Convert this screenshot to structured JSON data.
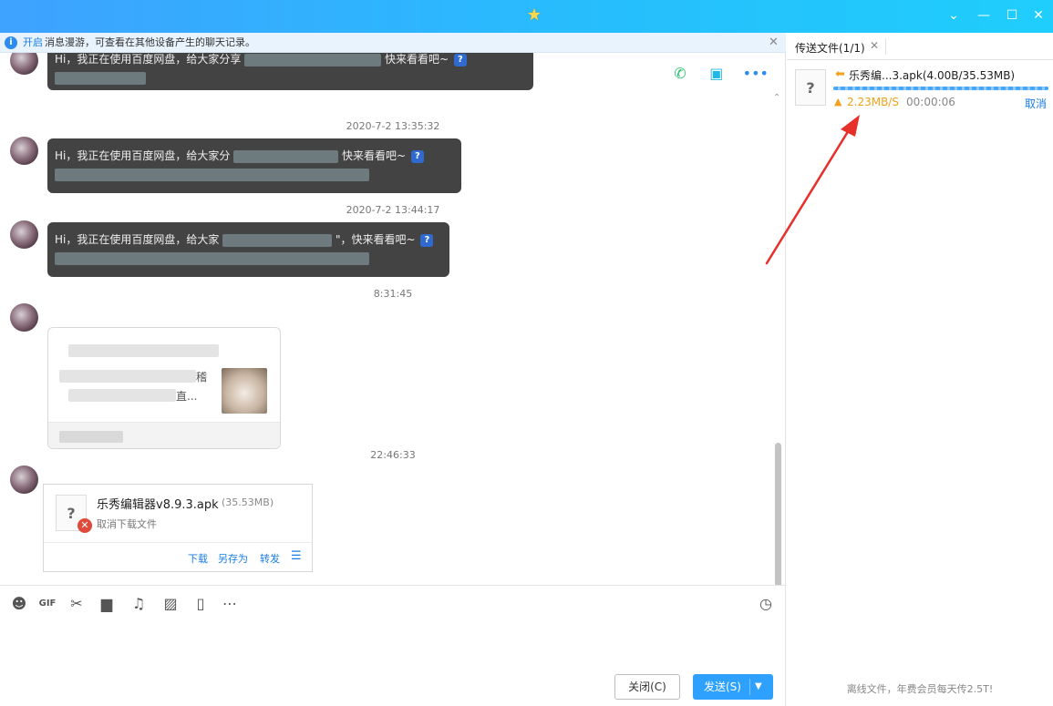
{
  "window": {
    "title_icon": "star-icon",
    "controls": [
      "minimize-icon",
      "maximize-icon",
      "close-icon"
    ]
  },
  "notice": {
    "link": "开启",
    "text": "消息漫游，可查看在其他设备产生的聊天记录。",
    "close": "✕"
  },
  "chat": {
    "messages": [
      {
        "type": "text",
        "text": "Hi，我正在使用百度网盘，给大家分享",
        "suffix": "快来看看吧~"
      },
      {
        "type": "time",
        "text": "2020-7-2 13:35:32"
      },
      {
        "type": "text",
        "text": "Hi，我正在使用百度网盘，给大家分",
        "suffix": "快来看看吧~"
      },
      {
        "type": "time",
        "text": "2020-7-2 13:44:17"
      },
      {
        "type": "text",
        "text": "Hi，我正在使用百度网盘，给大家",
        "suffix": "\"，快来看看吧~"
      },
      {
        "type": "time",
        "text": "8:31:45"
      },
      {
        "type": "card",
        "line1_tail": "稽",
        "line2_tail": "直..."
      },
      {
        "type": "time",
        "text": "22:46:33"
      },
      {
        "type": "file",
        "name": "乐秀编辑器v8.9.3.apk",
        "size": "(35.53MB)",
        "status": "取消下载文件",
        "actions": [
          "下载",
          "另存为",
          "转发"
        ]
      }
    ]
  },
  "toolbar": {
    "tools": [
      "emoji-icon",
      "gif-icon",
      "scissors-icon",
      "folder-icon",
      "music-icon",
      "image-icon",
      "shake-icon",
      "more-icon"
    ],
    "gif": "GIF"
  },
  "buttons": {
    "close": "关闭(C)",
    "send": "发送(S)"
  },
  "transfer": {
    "tab_label": "传送文件(1/1)",
    "file_name": "乐秀编...3.apk(4.00B/35.53MB)",
    "progress": 1.0,
    "speed": "2.23MB/S",
    "eta": "00:00:06",
    "cancel": "取消",
    "footer": "离线文件，年费会员每天传2.5T!"
  },
  "colors": {
    "accent": "#2ea1ff",
    "speed": "#f2a11c",
    "annotation": "#e8302a"
  }
}
